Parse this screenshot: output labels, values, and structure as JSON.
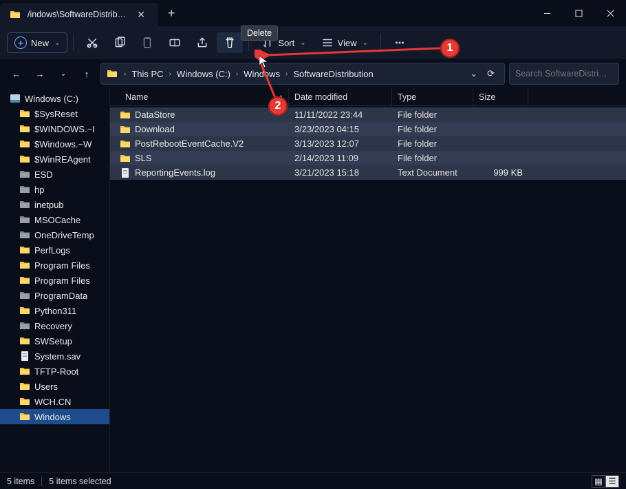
{
  "tab": {
    "title": "/indows\\SoftwareDistribution"
  },
  "tooltip": "Delete",
  "toolbar": {
    "new_label": "New",
    "sort_label": "Sort",
    "view_label": "View"
  },
  "breadcrumbs": [
    "This PC",
    "Windows (C:)",
    "Windows",
    "SoftwareDistribution"
  ],
  "search": {
    "placeholder": "Search SoftwareDistri…"
  },
  "columns": {
    "name": "Name",
    "date": "Date modified",
    "type": "Type",
    "size": "Size"
  },
  "sidebar": {
    "root": "Windows (C:)",
    "items": [
      {
        "label": "$SysReset",
        "icon": "folder"
      },
      {
        "label": "$WINDOWS.~I",
        "icon": "folder"
      },
      {
        "label": "$Windows.~W",
        "icon": "folder"
      },
      {
        "label": "$WinREAgent",
        "icon": "folder"
      },
      {
        "label": "ESD",
        "icon": "folder-g"
      },
      {
        "label": "hp",
        "icon": "folder-g"
      },
      {
        "label": "inetpub",
        "icon": "folder-g"
      },
      {
        "label": "MSOCache",
        "icon": "folder-g"
      },
      {
        "label": "OneDriveTemp",
        "icon": "folder-g"
      },
      {
        "label": "PerfLogs",
        "icon": "folder"
      },
      {
        "label": "Program Files",
        "icon": "folder"
      },
      {
        "label": "Program Files",
        "icon": "folder"
      },
      {
        "label": "ProgramData",
        "icon": "folder-g"
      },
      {
        "label": "Python311",
        "icon": "folder"
      },
      {
        "label": "Recovery",
        "icon": "folder-g"
      },
      {
        "label": "SWSetup",
        "icon": "folder"
      },
      {
        "label": "System.sav",
        "icon": "doc"
      },
      {
        "label": "TFTP-Root",
        "icon": "folder"
      },
      {
        "label": "Users",
        "icon": "folder"
      },
      {
        "label": "WCH.CN",
        "icon": "folder"
      },
      {
        "label": "Windows",
        "icon": "folder",
        "active": true
      }
    ]
  },
  "rows": [
    {
      "name": "DataStore",
      "date": "11/11/2022 23:44",
      "type": "File folder",
      "size": "",
      "icon": "folder"
    },
    {
      "name": "Download",
      "date": "3/23/2023 04:15",
      "type": "File folder",
      "size": "",
      "icon": "folder"
    },
    {
      "name": "PostRebootEventCache.V2",
      "date": "3/13/2023 12:07",
      "type": "File folder",
      "size": "",
      "icon": "folder"
    },
    {
      "name": "SLS",
      "date": "2/14/2023 11:09",
      "type": "File folder",
      "size": "",
      "icon": "folder"
    },
    {
      "name": "ReportingEvents.log",
      "date": "3/21/2023 15:18",
      "type": "Text Document",
      "size": "999 KB",
      "icon": "doc"
    }
  ],
  "status": {
    "count": "5 items",
    "selected": "5 items selected"
  },
  "callouts": {
    "one": "1",
    "two": "2"
  }
}
